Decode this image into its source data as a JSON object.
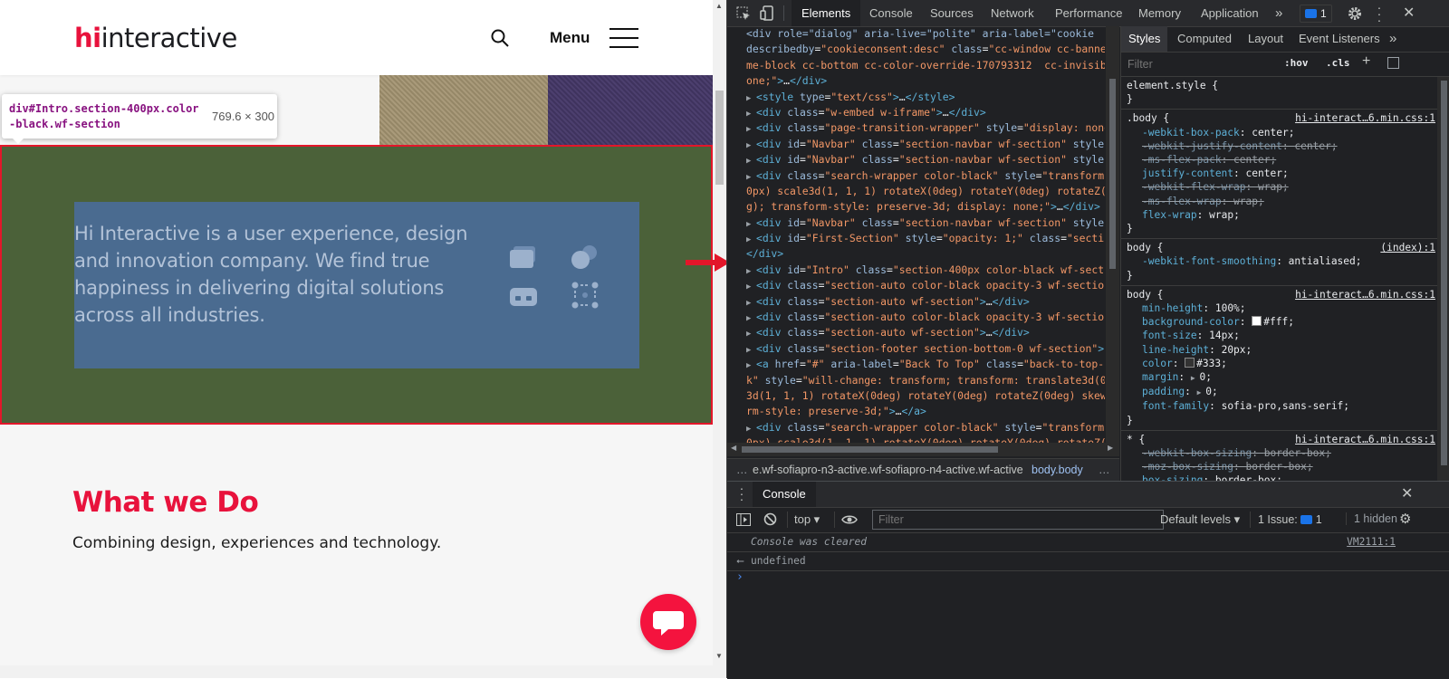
{
  "site": {
    "logo": {
      "mark": "hi",
      "word": "interactive"
    },
    "menu_label": "Menu",
    "tooltip": {
      "selector": "div#Intro.section-400px.color-black.wf-section",
      "size": "769.6 × 300"
    },
    "intro_text": "Hi Interactive is a user experience, design and innovation company. We find true happiness in delivering digital solutions across all industries.",
    "what_title": "What we Do",
    "what_subtitle": "Combining design, experiences and technology.",
    "colors": {
      "brand": "#e8123c",
      "intro_margin": "#4b6139",
      "intro_content": "#4a6b90",
      "highlight_border": "#e3162a"
    }
  },
  "devtools": {
    "tabs": [
      "Elements",
      "Console",
      "Sources",
      "Network",
      "Performance",
      "Memory",
      "Application"
    ],
    "active_tab": "Elements",
    "more_tabs": "»",
    "issues_badge": "1",
    "elements_lines": [
      {
        "indent": 0,
        "tri": "",
        "html": "<span class='attr'>&lt;div role=\"dialog\" aria-live=\"polite\" aria-label=\"cookie</span>"
      },
      {
        "indent": 0,
        "tri": "",
        "html": "<span class='attr'>describedby</span><span class='txt'>=</span><span class='val'>\"cookieconsent:desc\"</span> <span class='attr'>class</span><span class='txt'>=</span><span class='val'>\"cc-window cc-banne</span>"
      },
      {
        "indent": 0,
        "tri": "",
        "html": "<span class='val'>me-block cc-bottom cc-color-override-170793312  cc-invisib</span>"
      },
      {
        "indent": 0,
        "tri": "",
        "html": "<span class='val'>one;\"</span><span class='tag'>&gt;</span><span class='txt'>…</span><span class='tag'>&lt;/div&gt;</span>"
      },
      {
        "indent": 0,
        "tri": "▶",
        "html": "<span class='tag'>&lt;style </span><span class='attr'>type</span><span class='txt'>=</span><span class='val'>\"text/css\"</span><span class='tag'>&gt;</span><span class='txt'>…</span><span class='tag'>&lt;/style&gt;</span>"
      },
      {
        "indent": 0,
        "tri": "▶",
        "html": "<span class='tag'>&lt;div </span><span class='attr'>class</span><span class='txt'>=</span><span class='val'>\"w-embed w-iframe\"</span><span class='tag'>&gt;</span><span class='txt'>…</span><span class='tag'>&lt;/div&gt;</span>"
      },
      {
        "indent": 0,
        "tri": "▶",
        "html": "<span class='tag'>&lt;div </span><span class='attr'>class</span><span class='txt'>=</span><span class='val'>\"page-transition-wrapper\"</span> <span class='attr'>style</span><span class='txt'>=</span><span class='val'>\"display: none</span>"
      },
      {
        "indent": 0,
        "tri": "▶",
        "html": "<span class='tag'>&lt;div </span><span class='attr'>id</span><span class='txt'>=</span><span class='val'>\"Navbar\"</span> <span class='attr'>class</span><span class='txt'>=</span><span class='val'>\"section-navbar wf-section\"</span> <span class='attr'>style</span>"
      },
      {
        "indent": 0,
        "tri": "▶",
        "html": "<span class='tag'>&lt;div </span><span class='attr'>id</span><span class='txt'>=</span><span class='val'>\"Navbar\"</span> <span class='attr'>class</span><span class='txt'>=</span><span class='val'>\"section-navbar wf-section\"</span> <span class='attr'>style</span>"
      },
      {
        "indent": 0,
        "tri": "▶",
        "html": "<span class='tag'>&lt;div </span><span class='attr'>class</span><span class='txt'>=</span><span class='val'>\"search-wrapper color-black\"</span> <span class='attr'>style</span><span class='txt'>=</span><span class='val'>\"transform</span>"
      },
      {
        "indent": 0,
        "tri": "",
        "html": "<span class='val'>0px) scale3d(1, 1, 1) rotateX(0deg) rotateY(0deg) rotateZ(</span>"
      },
      {
        "indent": 0,
        "tri": "",
        "html": "<span class='val'>g); transform-style: preserve-3d; display: none;\"</span><span class='tag'>&gt;</span><span class='txt'>…</span><span class='tag'>&lt;/div&gt;</span>"
      },
      {
        "indent": 0,
        "tri": "▶",
        "html": "<span class='tag'>&lt;div </span><span class='attr'>id</span><span class='txt'>=</span><span class='val'>\"Navbar\"</span> <span class='attr'>class</span><span class='txt'>=</span><span class='val'>\"section-navbar wf-section\"</span> <span class='attr'>style</span>"
      },
      {
        "indent": 0,
        "tri": "▶",
        "html": "<span class='tag'>&lt;div </span><span class='attr'>id</span><span class='txt'>=</span><span class='val'>\"First-Section\"</span> <span class='attr'>style</span><span class='txt'>=</span><span class='val'>\"opacity: 1;\"</span> <span class='attr'>class</span><span class='txt'>=</span><span class='val'>\"secti</span>"
      },
      {
        "indent": 0,
        "tri": "",
        "html": "<span class='tag'>&lt;/div&gt;</span>"
      },
      {
        "indent": 0,
        "tri": "▶",
        "html": "<span class='tag'>&lt;div </span><span class='attr'>id</span><span class='txt'>=</span><span class='val'>\"Intro\"</span> <span class='attr'>class</span><span class='txt'>=</span><span class='val'>\"section-400px color-black wf-secti</span>"
      },
      {
        "indent": 0,
        "tri": "▶",
        "html": "<span class='tag'>&lt;div </span><span class='attr'>class</span><span class='txt'>=</span><span class='val'>\"section-auto color-black opacity-3 wf-sectio</span>"
      },
      {
        "indent": 0,
        "tri": "▶",
        "html": "<span class='tag'>&lt;div </span><span class='attr'>class</span><span class='txt'>=</span><span class='val'>\"section-auto wf-section\"</span><span class='tag'>&gt;</span><span class='txt'>…</span><span class='tag'>&lt;/div&gt;</span>"
      },
      {
        "indent": 0,
        "tri": "▶",
        "html": "<span class='tag'>&lt;div </span><span class='attr'>class</span><span class='txt'>=</span><span class='val'>\"section-auto color-black opacity-3 wf-sectio</span>"
      },
      {
        "indent": 0,
        "tri": "▶",
        "html": "<span class='tag'>&lt;div </span><span class='attr'>class</span><span class='txt'>=</span><span class='val'>\"section-auto wf-section\"</span><span class='tag'>&gt;</span><span class='txt'>…</span><span class='tag'>&lt;/div&gt;</span>"
      },
      {
        "indent": 0,
        "tri": "▶",
        "html": "<span class='tag'>&lt;div </span><span class='attr'>class</span><span class='txt'>=</span><span class='val'>\"section-footer section-bottom-0 wf-section\"</span><span class='tag'>&gt;</span>"
      },
      {
        "indent": 0,
        "tri": "▶",
        "html": "<span class='tag'>&lt;a </span><span class='attr'>href</span><span class='txt'>=</span><span class='val'>\"#\"</span> <span class='attr'>aria-label</span><span class='txt'>=</span><span class='val'>\"Back To Top\"</span> <span class='attr'>class</span><span class='txt'>=</span><span class='val'>\"back-to-top-</span>"
      },
      {
        "indent": 0,
        "tri": "",
        "html": "<span class='val'>k\"</span> <span class='attr'>style</span><span class='txt'>=</span><span class='val'>\"will-change: transform; transform: translate3d(0</span>"
      },
      {
        "indent": 0,
        "tri": "",
        "html": "<span class='val'>3d(1, 1, 1) rotateX(0deg) rotateY(0deg) rotateZ(0deg) skew</span>"
      },
      {
        "indent": 0,
        "tri": "",
        "html": "<span class='val'>rm-style: preserve-3d;\"</span><span class='tag'>&gt;</span><span class='txt'>…</span><span class='tag'>&lt;/a&gt;</span>"
      },
      {
        "indent": 0,
        "tri": "▶",
        "html": "<span class='tag'>&lt;div </span><span class='attr'>class</span><span class='txt'>=</span><span class='val'>\"search-wrapper color-black\"</span> <span class='attr'>style</span><span class='txt'>=</span><span class='val'>\"transform</span>"
      },
      {
        "indent": 0,
        "tri": "",
        "html": "<span class='val'>0px) scale3d(1, 1, 1) rotateX(0deg) rotateY(0deg) rotateZ(0</span>"
      }
    ],
    "breadcrumb": {
      "dots": "…",
      "item1": "e.wf-sofiapro-n3-active.wf-sofiapro-n4-active.wf-active",
      "item2": "body.body"
    },
    "styles_tabs": [
      "Styles",
      "Computed",
      "Layout",
      "Event Listeners"
    ],
    "styles_filter_placeholder": "Filter",
    "hov": ":hov",
    "cls": ".cls",
    "rules": [
      {
        "selector": "element.style {",
        "source": "",
        "decls": []
      },
      {
        "selector": ".body {",
        "source": "hi-interact…6.min.css:1",
        "decls": [
          {
            "n": "-webkit-box-pack",
            "v": "center",
            "strike": false
          },
          {
            "n": "-webkit-justify-content",
            "v": "center",
            "strike": true
          },
          {
            "n": "-ms-flex-pack",
            "v": "center",
            "strike": true
          },
          {
            "n": "justify-content",
            "v": "center",
            "strike": false
          },
          {
            "n": "-webkit-flex-wrap",
            "v": "wrap",
            "strike": true
          },
          {
            "n": "-ms-flex-wrap",
            "v": "wrap",
            "strike": true
          },
          {
            "n": "flex-wrap",
            "v": "wrap",
            "strike": false
          }
        ]
      },
      {
        "selector": "body {",
        "source": "(index):1",
        "decls": [
          {
            "n": "-webkit-font-smoothing",
            "v": "antialiased",
            "strike": false
          }
        ]
      },
      {
        "selector": "body {",
        "source": "hi-interact…6.min.css:1",
        "decls": [
          {
            "n": "min-height",
            "v": "100%",
            "strike": false
          },
          {
            "n": "background-color",
            "v": "#fff",
            "strike": false,
            "swatch": "#ffffff"
          },
          {
            "n": "font-size",
            "v": "14px",
            "strike": false
          },
          {
            "n": "line-height",
            "v": "20px",
            "strike": false
          },
          {
            "n": "color",
            "v": "#333",
            "strike": false,
            "swatch": "#333333"
          },
          {
            "n": "margin",
            "v": "0",
            "strike": false,
            "expand": true
          },
          {
            "n": "padding",
            "v": "0",
            "strike": false,
            "expand": true
          },
          {
            "n": "font-family",
            "v": "sofia-pro,sans-serif",
            "strike": false
          }
        ]
      },
      {
        "selector": "* {",
        "source": "hi-interact…6.min.css:1",
        "decls": [
          {
            "n": "-webkit-box-sizing",
            "v": "border-box",
            "strike": true
          },
          {
            "n": "-moz-box-sizing",
            "v": "border-box",
            "strike": true
          },
          {
            "n": "box-sizing",
            "v": "border-box",
            "strike": false
          }
        ]
      }
    ],
    "drawer_tab": "Console",
    "console_context": "top ▾",
    "console_filter_placeholder": "Filter",
    "default_levels": "Default levels ▾",
    "issues_text": "1 Issue:",
    "issues_count": "1",
    "hidden_text": "1 hidden",
    "messages": {
      "cleared": "Console was cleared",
      "cleared_src": "VM2111:1",
      "result": "undefined",
      "prompt": "›"
    }
  }
}
